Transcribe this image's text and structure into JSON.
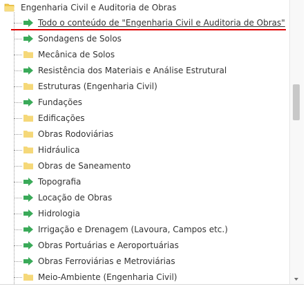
{
  "tree": {
    "root": {
      "label": "Engenharia Civil e Auditoria de Obras",
      "icon": "folder-open-icon"
    },
    "items": [
      {
        "label": "Todo o conteúdo de \"Engenharia Civil e Auditoria de Obras\"",
        "icon": "arrow-right-icon",
        "selected": true
      },
      {
        "label": "Sondagens de Solos",
        "icon": "arrow-right-icon"
      },
      {
        "label": "Mecânica de Solos",
        "icon": "folder-icon"
      },
      {
        "label": "Resistência dos Materiais e Análise Estrutural",
        "icon": "arrow-right-icon"
      },
      {
        "label": "Estruturas (Engenharia Civil)",
        "icon": "folder-icon"
      },
      {
        "label": "Fundações",
        "icon": "arrow-right-icon"
      },
      {
        "label": "Edificações",
        "icon": "folder-icon"
      },
      {
        "label": "Obras Rodoviárias",
        "icon": "folder-icon"
      },
      {
        "label": "Hidráulica",
        "icon": "folder-icon"
      },
      {
        "label": "Obras de Saneamento",
        "icon": "folder-icon"
      },
      {
        "label": "Topografia",
        "icon": "arrow-right-icon"
      },
      {
        "label": "Locação de Obras",
        "icon": "arrow-right-icon"
      },
      {
        "label": "Hidrologia",
        "icon": "arrow-right-icon"
      },
      {
        "label": "Irrigação e Drenagem (Lavoura, Campos etc.)",
        "icon": "arrow-right-icon"
      },
      {
        "label": "Obras Portuárias e Aeroportuárias",
        "icon": "arrow-right-icon"
      },
      {
        "label": "Obras Ferroviárias e Metroviárias",
        "icon": "arrow-right-icon"
      },
      {
        "label": "Meio-Ambiente (Engenharia Civil)",
        "icon": "folder-icon"
      }
    ]
  },
  "colors": {
    "folder": "#f5d879",
    "arrow": "#33a852",
    "selection_underline": "#e00000"
  }
}
